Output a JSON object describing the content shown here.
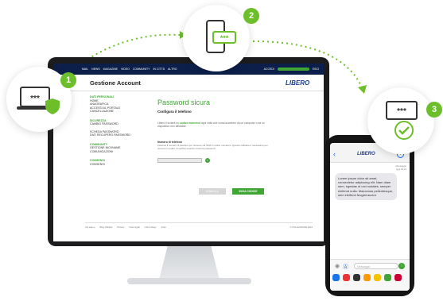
{
  "steps": [
    {
      "number": "1"
    },
    {
      "number": "2"
    },
    {
      "number": "3"
    }
  ],
  "step_icons": {
    "mask_text": "***"
  },
  "website": {
    "nav": [
      "MAIL",
      "NEWS",
      "MAGAZINE",
      "VIDEO",
      "COMMUNITY",
      "IN CITTÀ",
      "ALTRO"
    ],
    "nav_right": [
      "ACCEDI",
      "ESCI"
    ],
    "page_title": "Gestione Account",
    "brand": "LIBERO",
    "sidebar": [
      {
        "section": "DATI PERSONALI",
        "items": [
          "HOME",
          "ANAGRAFICA",
          "ACCESSI AL PORTALE",
          "CANCELLAZIONE"
        ]
      },
      {
        "section": "SICUREZZA",
        "items": [
          "CAMBIO PASSWORD",
          "SCHEDA PASSWORD",
          "DATI RECUPERO PASSWORD"
        ]
      },
      {
        "section": "COMMUNITY",
        "items": [
          "GESTIONE NICKNAME",
          "COMUNICAZIONI"
        ]
      },
      {
        "section": "CONSENSI",
        "items": [
          "CONSENSI"
        ]
      }
    ],
    "main": {
      "title": "Password sicura",
      "subtitle": "Configura il telefono",
      "intro_before": "Libero ti invierà un ",
      "intro_bold": "codice numerico",
      "intro_after": " ogni volta che vorrai accedere da un computer o da un dispositivo non affidabile.",
      "number_label": "Numero di telefono",
      "number_help": "Inserisci il numero di telefono per ricevere via SMS il codice numerico. Questo cellulare è necessario per ricevere il codice di verifica quando cambi la password.",
      "ok_symbol": "✓",
      "cancel_label": "ANNULLA",
      "send_label": "INVIA CODICE"
    },
    "footer_links": [
      "Chi siamo",
      "Blog ufficiale",
      "Privacy",
      "Note legali",
      "Libero Easy",
      "Aiuto"
    ],
    "footer_copy": "© ITALIAONLINE 2016"
  },
  "phone": {
    "back": "‹",
    "contact": "LIBERO",
    "info": "i",
    "date": "Messaggio",
    "time": "oggi 09:41",
    "message": "Lorem ipsum dolor sit amet, consectetur adipiscing elit. Nam diam sem, egestas ut orci sodales, semper eleifend nulla. Maecenas pellentesque, sem eleifend feugiat auctor",
    "input_placeholder": "Messaggio",
    "send": "↑"
  },
  "colors": {
    "accent": "#3fa535",
    "navy": "#0b1f4a",
    "badge": "#6cbf2a"
  }
}
